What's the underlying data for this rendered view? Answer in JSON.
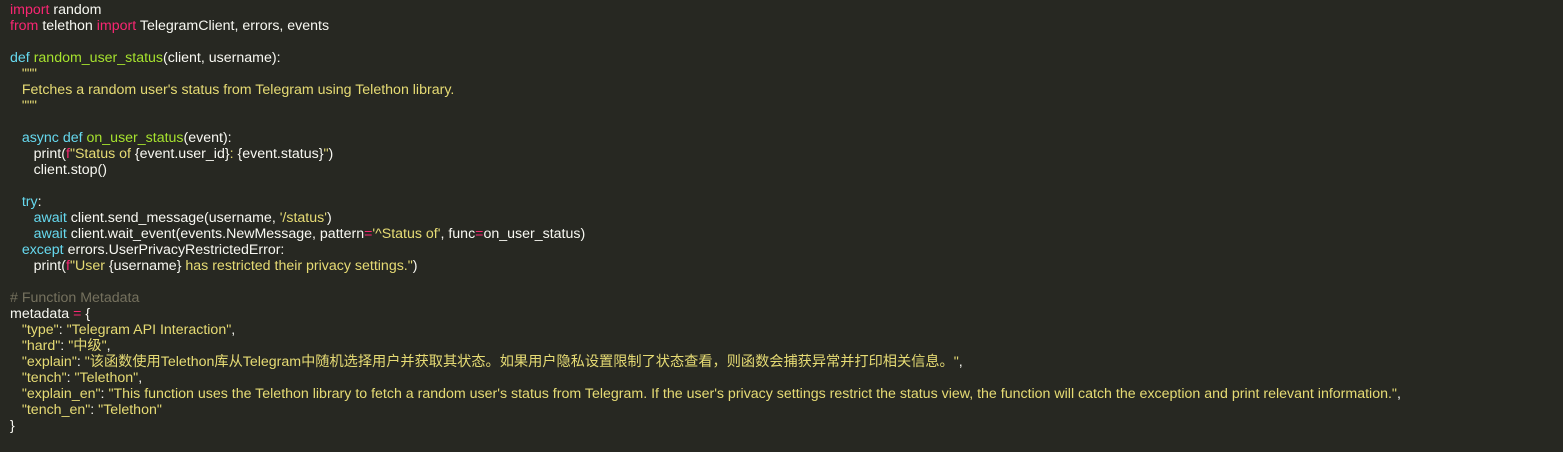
{
  "colors": {
    "background": "#272822",
    "text": "#f8f8f2",
    "keyword": "#f92672",
    "definition": "#66d9ef",
    "function": "#a6e22e",
    "string": "#e6db74",
    "comment": "#75715e"
  },
  "code": {
    "lines": [
      [
        {
          "c": "kw",
          "t": "import"
        },
        {
          "c": "plain",
          "t": " random"
        }
      ],
      [
        {
          "c": "kw",
          "t": "from"
        },
        {
          "c": "plain",
          "t": " telethon "
        },
        {
          "c": "kw",
          "t": "import"
        },
        {
          "c": "plain",
          "t": " TelegramClient, errors, events"
        }
      ],
      [],
      [
        {
          "c": "def",
          "t": "def"
        },
        {
          "c": "plain",
          "t": " "
        },
        {
          "c": "fn",
          "t": "random_user_status"
        },
        {
          "c": "plain",
          "t": "(client, username):"
        }
      ],
      [
        {
          "c": "str",
          "t": "   \"\"\""
        }
      ],
      [
        {
          "c": "str",
          "t": "   Fetches a random user's status from Telegram using Telethon library."
        }
      ],
      [
        {
          "c": "str",
          "t": "   \"\"\""
        }
      ],
      [],
      [
        {
          "c": "plain",
          "t": "   "
        },
        {
          "c": "def",
          "t": "async def"
        },
        {
          "c": "plain",
          "t": " "
        },
        {
          "c": "fn",
          "t": "on_user_status"
        },
        {
          "c": "plain",
          "t": "(event):"
        }
      ],
      [
        {
          "c": "plain",
          "t": "      print("
        },
        {
          "c": "kw",
          "t": "f"
        },
        {
          "c": "str",
          "t": "\"Status of "
        },
        {
          "c": "plain",
          "t": "{event.user_id}"
        },
        {
          "c": "str",
          "t": ": "
        },
        {
          "c": "plain",
          "t": "{event.status}"
        },
        {
          "c": "str",
          "t": "\""
        },
        {
          "c": "plain",
          "t": ")"
        }
      ],
      [
        {
          "c": "plain",
          "t": "      client.stop()"
        }
      ],
      [],
      [
        {
          "c": "plain",
          "t": "   "
        },
        {
          "c": "def",
          "t": "try"
        },
        {
          "c": "plain",
          "t": ":"
        }
      ],
      [
        {
          "c": "plain",
          "t": "      "
        },
        {
          "c": "def",
          "t": "await"
        },
        {
          "c": "plain",
          "t": " client.send_message(username, "
        },
        {
          "c": "str",
          "t": "'/status'"
        },
        {
          "c": "plain",
          "t": ")"
        }
      ],
      [
        {
          "c": "plain",
          "t": "      "
        },
        {
          "c": "def",
          "t": "await"
        },
        {
          "c": "plain",
          "t": " client.wait_event(events.NewMessage, pattern"
        },
        {
          "c": "kw",
          "t": "="
        },
        {
          "c": "str",
          "t": "'^Status of'"
        },
        {
          "c": "plain",
          "t": ", func"
        },
        {
          "c": "kw",
          "t": "="
        },
        {
          "c": "plain",
          "t": "on_user_status)"
        }
      ],
      [
        {
          "c": "plain",
          "t": "   "
        },
        {
          "c": "def",
          "t": "except"
        },
        {
          "c": "plain",
          "t": " errors.UserPrivacyRestrictedError:"
        }
      ],
      [
        {
          "c": "plain",
          "t": "      print("
        },
        {
          "c": "kw",
          "t": "f"
        },
        {
          "c": "str",
          "t": "\"User "
        },
        {
          "c": "plain",
          "t": "{username}"
        },
        {
          "c": "str",
          "t": " has restricted their privacy settings.\""
        },
        {
          "c": "plain",
          "t": ")"
        }
      ],
      [],
      [
        {
          "c": "cm",
          "t": "# Function Metadata"
        }
      ],
      [
        {
          "c": "plain",
          "t": "metadata "
        },
        {
          "c": "kw",
          "t": "="
        },
        {
          "c": "plain",
          "t": " {"
        }
      ],
      [
        {
          "c": "plain",
          "t": "   "
        },
        {
          "c": "str",
          "t": "\"type\""
        },
        {
          "c": "plain",
          "t": ": "
        },
        {
          "c": "str",
          "t": "\"Telegram API Interaction\""
        },
        {
          "c": "plain",
          "t": ","
        }
      ],
      [
        {
          "c": "plain",
          "t": "   "
        },
        {
          "c": "str",
          "t": "\"hard\""
        },
        {
          "c": "plain",
          "t": ": "
        },
        {
          "c": "str",
          "t": "\"中级\""
        },
        {
          "c": "plain",
          "t": ","
        }
      ],
      [
        {
          "c": "plain",
          "t": "   "
        },
        {
          "c": "str",
          "t": "\"explain\""
        },
        {
          "c": "plain",
          "t": ": "
        },
        {
          "c": "str",
          "t": "\"该函数使用Telethon库从Telegram中随机选择用户并获取其状态。如果用户隐私设置限制了状态查看，则函数会捕获异常并打印相关信息。\""
        },
        {
          "c": "plain",
          "t": ","
        }
      ],
      [
        {
          "c": "plain",
          "t": "   "
        },
        {
          "c": "str",
          "t": "\"tench\""
        },
        {
          "c": "plain",
          "t": ": "
        },
        {
          "c": "str",
          "t": "\"Telethon\""
        },
        {
          "c": "plain",
          "t": ","
        }
      ],
      [
        {
          "c": "plain",
          "t": "   "
        },
        {
          "c": "str",
          "t": "\"explain_en\""
        },
        {
          "c": "plain",
          "t": ": "
        },
        {
          "c": "str",
          "t": "\"This function uses the Telethon library to fetch a random user's status from Telegram. If the user's privacy settings restrict the status view, the function will catch the exception and print relevant information.\""
        },
        {
          "c": "plain",
          "t": ","
        }
      ],
      [
        {
          "c": "plain",
          "t": "   "
        },
        {
          "c": "str",
          "t": "\"tench_en\""
        },
        {
          "c": "plain",
          "t": ": "
        },
        {
          "c": "str",
          "t": "\"Telethon\""
        }
      ],
      [
        {
          "c": "plain",
          "t": "}"
        }
      ]
    ]
  }
}
